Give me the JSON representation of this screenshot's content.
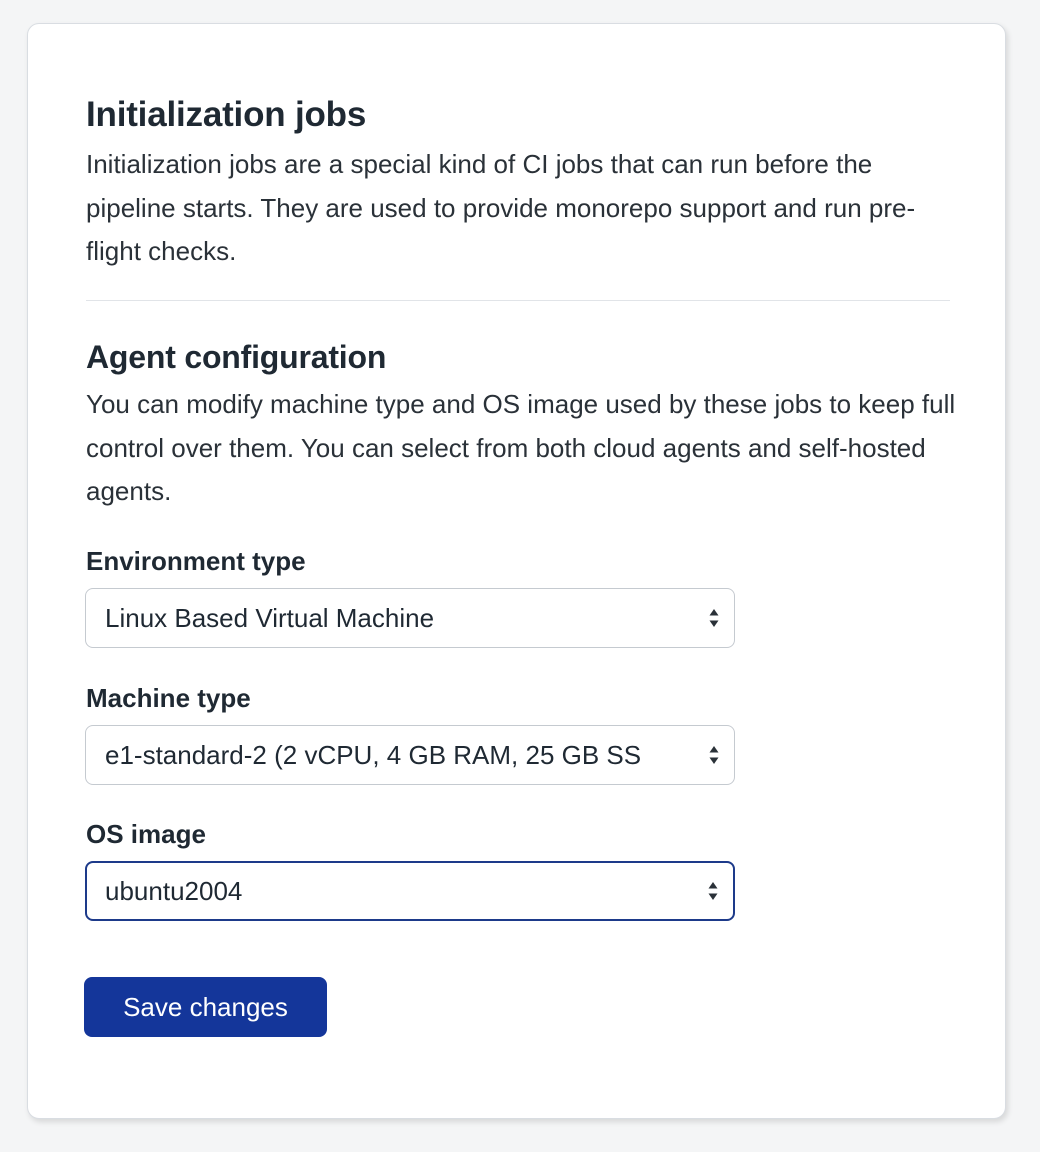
{
  "initialization": {
    "title": "Initialization jobs",
    "description": "Initialization jobs are a special kind of CI jobs that can run before the pipeline starts. They are used to provide monorepo support and run pre-flight checks."
  },
  "agent": {
    "title": "Agent configuration",
    "description": "You can modify machine type and OS image used by these jobs to keep full control over them. You can select from both cloud agents and self-hosted agents."
  },
  "fields": {
    "environment_type": {
      "label": "Environment type",
      "value": "Linux Based Virtual Machine"
    },
    "machine_type": {
      "label": "Machine type",
      "value": "e1-standard-2 (2 vCPU, 4 GB RAM, 25 GB SS"
    },
    "os_image": {
      "label": "OS image",
      "value": "ubuntu2004"
    }
  },
  "actions": {
    "save_label": "Save changes"
  },
  "icons": {
    "select_arrow": "chevron-up-down-icon"
  },
  "colors": {
    "primary_button": "#14369a",
    "focus_border": "#1d3a8a",
    "text": "#1f2933"
  }
}
